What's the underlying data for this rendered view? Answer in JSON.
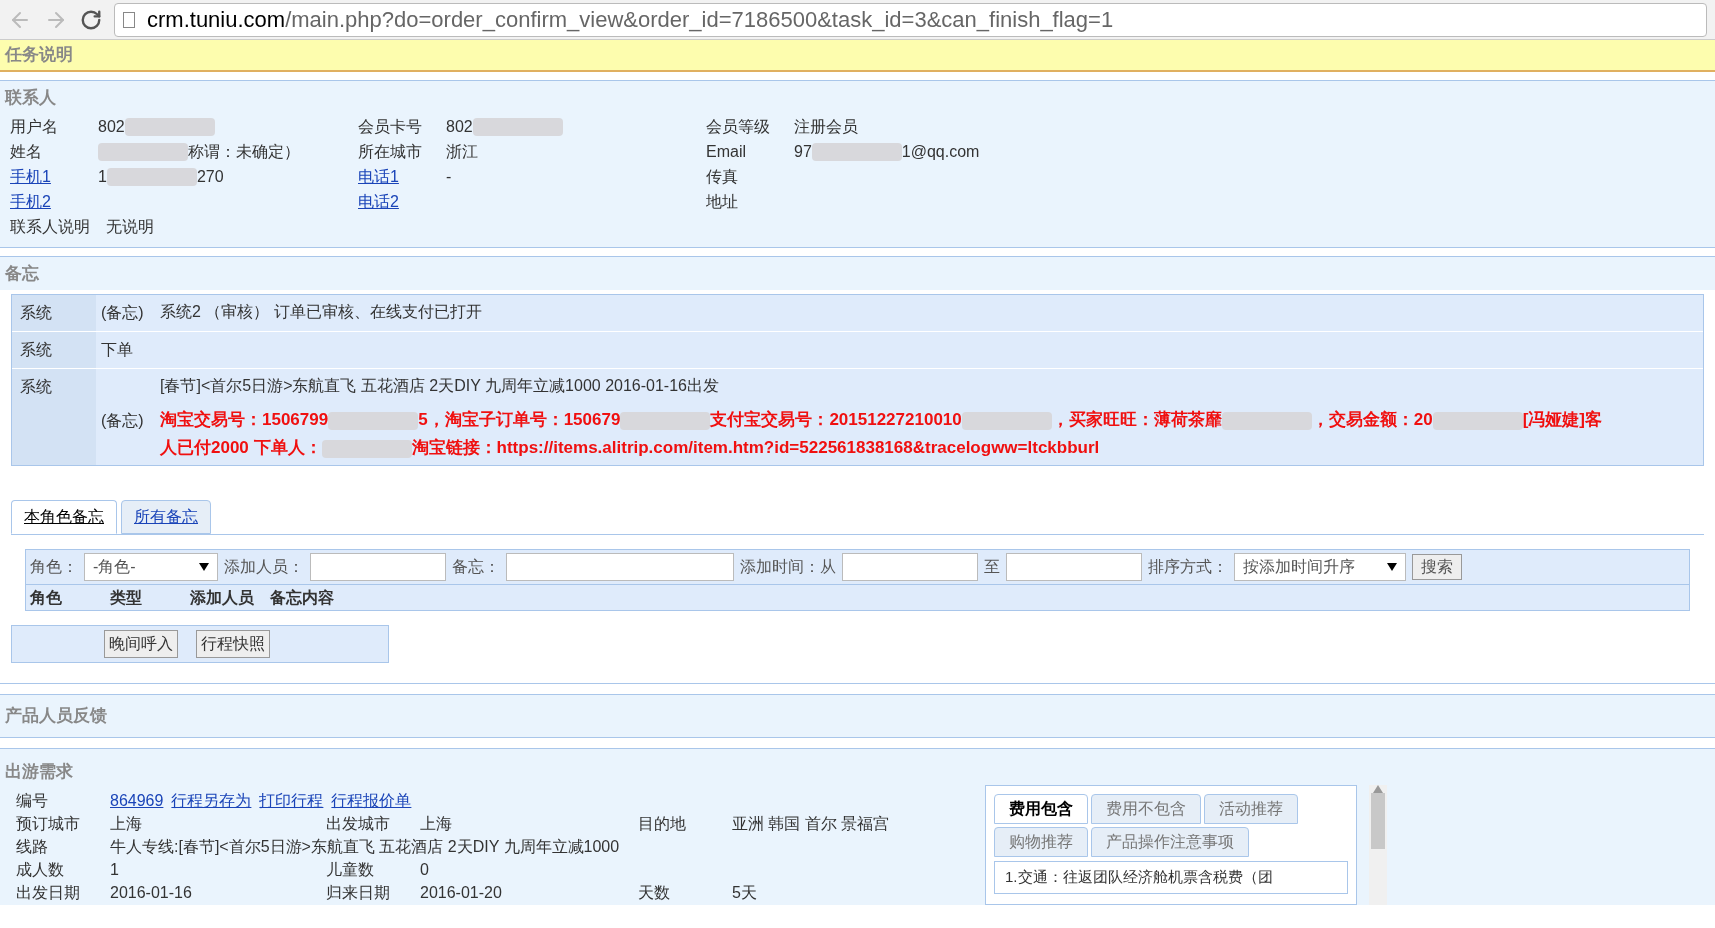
{
  "browser": {
    "url_host": "crm.tuniu.com",
    "url_path": "/main.php?do=order_confirm_view&order_id=7186500&task_id=3&can_finish_flag=1"
  },
  "task_bar": {
    "title": "任务说明"
  },
  "contact": {
    "title": "联系人",
    "columns": [
      [
        {
          "label": "用户名",
          "link": false,
          "value": [
            {
              "kind": "text",
              "text": "802"
            },
            {
              "kind": "blur"
            }
          ]
        },
        {
          "label": "姓名",
          "link": false,
          "value": [
            {
              "kind": "blur"
            },
            {
              "kind": "text",
              "text": "称谓：未确定）"
            }
          ]
        },
        {
          "label": "手机1",
          "link": true,
          "value": [
            {
              "kind": "text",
              "text": "1"
            },
            {
              "kind": "blur"
            },
            {
              "kind": "text",
              "text": "270"
            }
          ]
        },
        {
          "label": "手机2",
          "link": true
        }
      ],
      [
        {
          "label": "会员卡号",
          "link": false,
          "value": [
            {
              "kind": "text",
              "text": "802"
            },
            {
              "kind": "blur"
            }
          ]
        },
        {
          "label": "所在城市",
          "link": false,
          "value": [
            {
              "kind": "text",
              "text": "浙江"
            }
          ]
        },
        {
          "label": "电话1",
          "link": true,
          "value": [
            {
              "kind": "text",
              "text": "-"
            }
          ]
        },
        {
          "label": "电话2",
          "link": true
        }
      ],
      [
        {
          "label": "会员等级",
          "link": false,
          "value": [
            {
              "kind": "text",
              "text": "注册会员"
            }
          ]
        },
        {
          "label": "Email",
          "link": false,
          "value": [
            {
              "kind": "text",
              "text": "97"
            },
            {
              "kind": "blur"
            },
            {
              "kind": "text",
              "text": "1@qq.com"
            }
          ]
        },
        {
          "label": "传真",
          "link": false
        },
        {
          "label": "地址",
          "link": false
        }
      ]
    ],
    "note": {
      "label": "联系人说明",
      "value": "无说明"
    }
  },
  "memo": {
    "title": "备忘",
    "rows": [
      {
        "author": "系统",
        "lines": [
          {
            "tag": "(备忘)",
            "emphasis": false,
            "parts": [
              {
                "kind": "text",
                "text": "系统2 （审核） 订单已审核、在线支付已打开"
              }
            ]
          }
        ]
      },
      {
        "author": "系统",
        "lines": [
          {
            "tag": "下单"
          }
        ]
      },
      {
        "author": "系统",
        "lines": [
          {
            "emphasis": false,
            "parts": [
              {
                "kind": "text",
                "text": "[春节]<首尔5日游>东航直飞 五花酒店 2天DIY 九周年立减1000 2016-01-16出发"
              }
            ]
          },
          {
            "tag": "(备忘)",
            "emphasis": true,
            "parts": [
              {
                "kind": "text",
                "text": "淘宝交易号：1506799"
              },
              {
                "kind": "blur"
              },
              {
                "kind": "text",
                "text": "5，淘宝子订单号：150679"
              },
              {
                "kind": "blur"
              },
              {
                "kind": "text",
                "text": "支付宝交易号：20151227210010"
              },
              {
                "kind": "blur"
              },
              {
                "kind": "text",
                "text": "，买家旺旺：薄荷茶靡"
              },
              {
                "kind": "blur"
              },
              {
                "kind": "text",
                "text": "，交易金额：20"
              },
              {
                "kind": "blur"
              },
              {
                "kind": "text",
                "text": "[冯娅婕]客"
              },
              {
                "kind": "text",
                "text": "人已付2000 下单人："
              },
              {
                "kind": "blur"
              },
              {
                "kind": "text",
                "text": "淘宝链接：https://items.alitrip.com/item.htm?id=522561838168&tracelogww=ltckbburl"
              }
            ]
          }
        ]
      }
    ],
    "tabs": [
      {
        "label": "本角色备忘",
        "selected": true
      },
      {
        "label": "所有备忘",
        "selected": false
      }
    ],
    "filter": {
      "role_label": "角色：",
      "role_value": "-角色-",
      "adder_label": "添加人员：",
      "memo_label": "备忘：",
      "time_label": "添加时间：从",
      "to_label": "至",
      "sort_label": "排序方式：",
      "sort_value": "按添加时间升序",
      "search_button": "搜索"
    },
    "columns": [
      "角色",
      "类型",
      "添加人员",
      "备忘内容"
    ],
    "buttons": [
      "晚间呼入",
      "行程快照"
    ]
  },
  "feedback": {
    "title": "产品人员反馈"
  },
  "trip": {
    "title": "出游需求",
    "id_label": "编号",
    "id": "864969",
    "links": [
      "行程另存为",
      "打印行程",
      "行程报价单"
    ],
    "rows": [
      [
        {
          "label": "预订城市",
          "value": "上海"
        },
        {
          "label": "出发城市",
          "value": "上海"
        },
        {
          "label": "目的地",
          "value": "亚洲 韩国 首尔 景福宫"
        }
      ],
      [
        {
          "label": "线路",
          "value": "牛人专线:[春节]<首尔5日游>东航直飞 五花酒店 2天DIY 九周年立减1000"
        }
      ],
      [
        {
          "label": "成人数",
          "value": "1"
        },
        {
          "label": "儿童数",
          "value": "0"
        }
      ],
      [
        {
          "label": "出发日期",
          "value": "2016-01-16"
        },
        {
          "label": "归来日期",
          "value": "2016-01-20"
        },
        {
          "label": "天数",
          "value": "5天"
        }
      ]
    ],
    "panel_tabs": [
      {
        "label": "费用包含",
        "selected": true
      },
      {
        "label": "费用不包含",
        "selected": false
      },
      {
        "label": "活动推荐",
        "selected": false
      },
      {
        "label": "购物推荐",
        "selected": false
      },
      {
        "label": "产品操作注意事项",
        "selected": false
      }
    ],
    "panel_text": "1.交通：往返团队经济舱机票含税费（团"
  }
}
